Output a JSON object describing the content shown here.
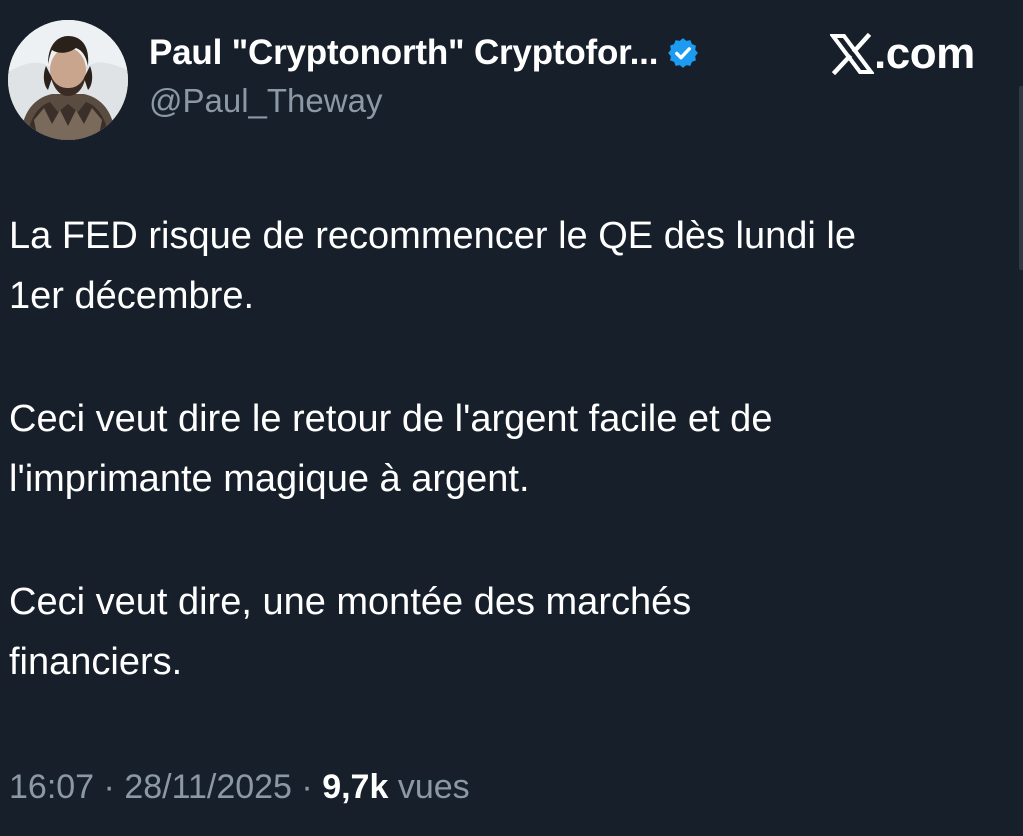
{
  "author": {
    "display_name": "Paul \"Cryptonorth\" Cryptofor...",
    "handle": "@Paul_Theway",
    "verified": true,
    "avatar_icon": "avatar-icon"
  },
  "brand": {
    "logo_icon": "x-logo-icon",
    "suffix": ".com"
  },
  "post": {
    "paragraphs": [
      "La FED risque de recommencer le QE dès lundi le\n1er décembre.",
      "Ceci veut dire le retour de l'argent facile et de\nl'imprimante magique à argent.",
      "Ceci veut dire, une montée des marchés\nfinanciers."
    ]
  },
  "meta": {
    "time": "16:07",
    "separator": " · ",
    "date": "28/11/2025",
    "views_count": "9,7k",
    "views_label": "vues"
  },
  "colors": {
    "background": "#17202a",
    "text_primary": "#ffffff",
    "text_secondary": "#8b98a5",
    "verified_badge": "#1d9bf0"
  }
}
